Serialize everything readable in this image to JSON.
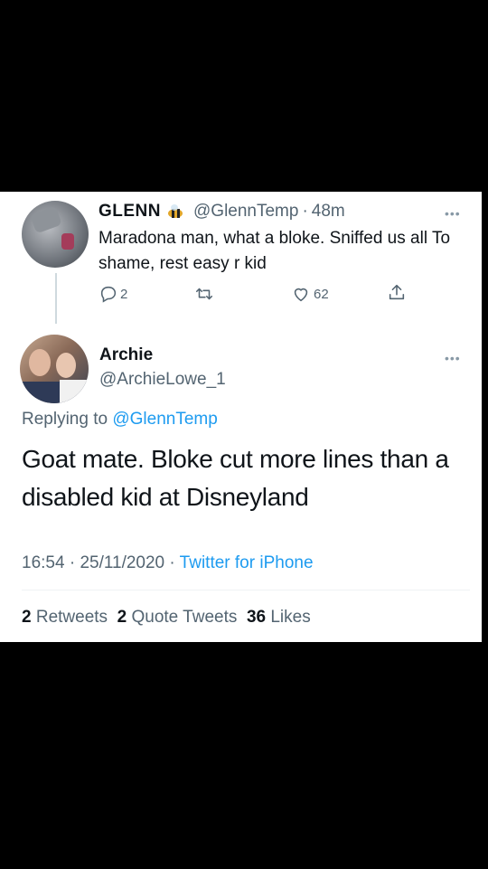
{
  "parent_tweet": {
    "display_name": "GLENN",
    "badge_icon": "bee-emoji",
    "handle": "@GlennTemp",
    "separator": "·",
    "time": "48m",
    "more_icon": "more-dots-icon",
    "text": "Maradona man, what a bloke. Sniffed us all To shame, rest easy r kid",
    "replies": "2",
    "retweets": "",
    "likes": "62"
  },
  "reply_tweet": {
    "display_name": "Archie",
    "handle": "@ArchieLowe_1",
    "more_icon": "more-dots-icon",
    "replying_prefix": "Replying to",
    "replying_to": "@GlennTemp",
    "text": "Goat mate. Bloke cut more lines than a disabled kid at Disneyland",
    "time": "16:54",
    "date": "25/11/2020",
    "separator": "·",
    "source": "Twitter for iPhone",
    "retweets_count": "2",
    "retweets_label": "Retweets",
    "quotes_count": "2",
    "quotes_label": "Quote Tweets",
    "likes_count": "36",
    "likes_label": "Likes"
  },
  "colors": {
    "link": "#1d9bf0",
    "secondary_text": "#536471",
    "primary_text": "#0f1419"
  }
}
